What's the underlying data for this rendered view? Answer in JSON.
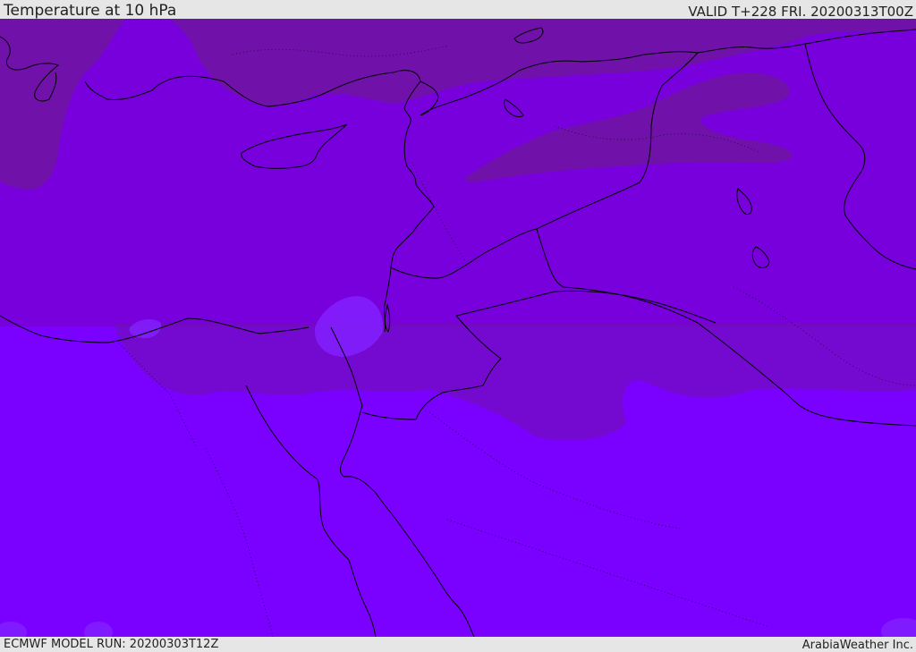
{
  "header": {
    "title": "Temperature at 10 hPa",
    "valid": "VALID T+228 FRI. 20200313T00Z"
  },
  "footer": {
    "model_run": "ECMWF MODEL RUN: 20200303T12Z",
    "credit": "ArabiaWeather Inc."
  },
  "map": {
    "field": "temperature",
    "level": "10 hPa",
    "colors": {
      "coldest_band": "#7012aa",
      "cold_band": "#7700dd",
      "warm_band": "#7a00ff",
      "warm_patch": "#8320ff",
      "coastline": "#000000"
    }
  }
}
